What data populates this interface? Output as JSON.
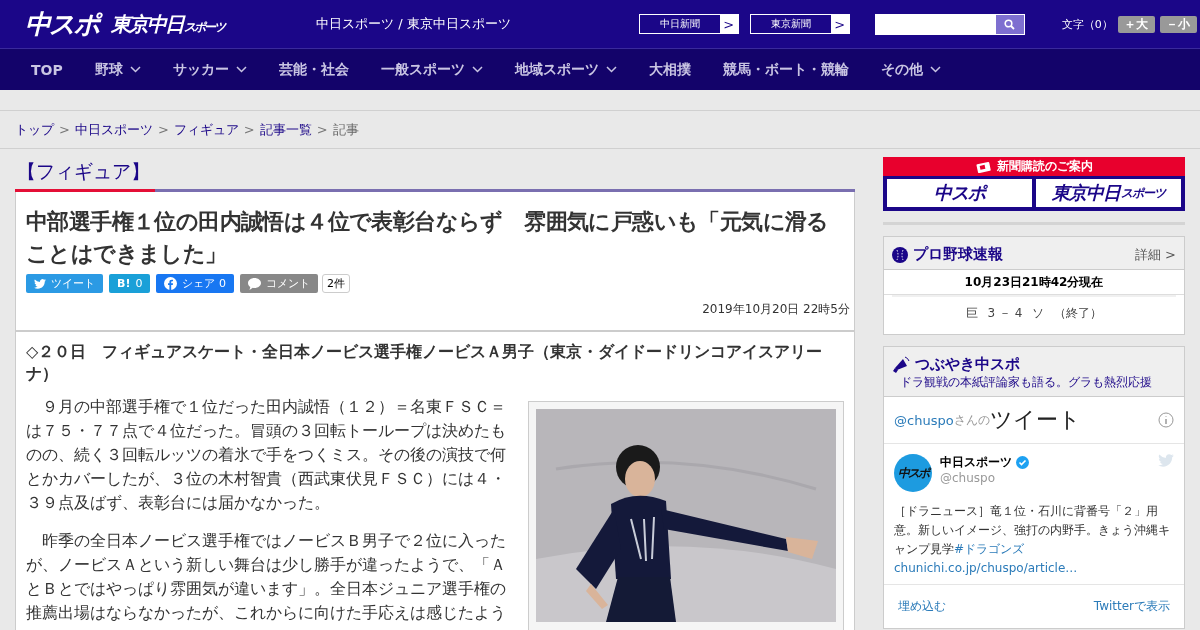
{
  "header": {
    "logo_main": "中スポ",
    "logo_sub": "東京中日",
    "logo_sub_small": "スポーツ",
    "site_title": "中日スポーツ / 東京中日スポーツ",
    "paper_links": [
      {
        "label": "中日新聞",
        "arrow": ">"
      },
      {
        "label": "東京新聞",
        "arrow": ">"
      }
    ],
    "font_size": {
      "label": "文字（0）",
      "buttons": [
        "＋大",
        "－小"
      ]
    }
  },
  "nav": [
    {
      "label": "TOP",
      "has_menu": false
    },
    {
      "label": "野球",
      "has_menu": true
    },
    {
      "label": "サッカー",
      "has_menu": true
    },
    {
      "label": "芸能・社会",
      "has_menu": false
    },
    {
      "label": "一般スポーツ",
      "has_menu": true
    },
    {
      "label": "地域スポーツ",
      "has_menu": true
    },
    {
      "label": "大相撲",
      "has_menu": false
    },
    {
      "label": "競馬・ボート・競輪",
      "has_menu": false
    },
    {
      "label": "その他",
      "has_menu": true
    }
  ],
  "breadcrumb": [
    {
      "label": "トップ",
      "link": true
    },
    {
      "label": "中日スポーツ",
      "link": true
    },
    {
      "label": "フィギュア",
      "link": true
    },
    {
      "label": "記事一覧",
      "link": true
    },
    {
      "label": "記事",
      "link": false
    }
  ],
  "breadcrumb_separator": ">",
  "category": "【フィギュア】",
  "article": {
    "title": "中部選手権１位の田内誠悟は４位で表彰台ならず　雰囲気に戸惑いも「元気に滑ることはできました」",
    "share": [
      {
        "kind": "twitter",
        "label": "ツイート"
      },
      {
        "kind": "hatena",
        "label": "B!",
        "count": "0"
      },
      {
        "kind": "facebook",
        "label": "シェア",
        "count": "0"
      },
      {
        "kind": "comment",
        "label": "コメント"
      }
    ],
    "comment_count": "2件",
    "date": "2019年10月20日 22時5分",
    "lead": "◇２０日　フィギュアスケート・全日本ノービス選手権ノービスＡ男子（東京・ダイドードリンコアイスアリーナ）",
    "paragraphs": [
      "　９月の中部選手権で１位だった田内誠悟（１２）＝名東ＦＳＣ＝は７５・７７点で４位だった。冒頭の３回転トーループは決めたものの、続く３回転ルッツの着氷で手をつくミス。その後の演技で何とかカバーしたが、３位の木村智貴（西武東伏見ＦＳＣ）には４・３９点及ばず、表彰台には届かなかった。",
      "　昨季の全日本ノービス選手権ではノービスＢ男子で２位に入ったが、ノービスＡという新しい舞台は少し勝手が違ったようで、「ＡとＢとではやっぱり雰囲気が違います」。全日本ジュニア選手権の推薦出場はならなかったが、これからに向けた手応えは感じたよう"
    ]
  },
  "sidebar": {
    "subscribe": {
      "title": "新聞購読のご案内",
      "logos": [
        {
          "main": "中スポ"
        },
        {
          "main": "東京中日",
          "small": "スポーツ"
        }
      ]
    },
    "baseball": {
      "title": "プロ野球速報",
      "more": "詳細 >",
      "updated": "10月23日21時42分現在",
      "games": [
        {
          "home": "巨",
          "score": "3 － 4",
          "away": "ソ",
          "status": "（終了）"
        }
      ]
    },
    "tweets": {
      "title": "つぶやき中スポ",
      "subtitle": "ドラ観戦の本紙評論家も語る。グラも熱烈応援",
      "widget_handle": "@chuspo",
      "widget_suffix": "さんの",
      "widget_title": "ツイート",
      "tweet": {
        "avatar_text": "中スポ",
        "name": "中日スポーツ",
        "verified": true,
        "handle": "@chuspo",
        "text": "［ドラニュース］竜１位・石川に背番号「２」用意。新しいイメージ、強打の内野手。きょう沖縄キャンプ見学",
        "hashtag": "#ドラゴンズ",
        "link": "chunichi.co.jp/chuspo/article…"
      },
      "embed": "埋め込む",
      "view": "Twitterで表示"
    }
  }
}
